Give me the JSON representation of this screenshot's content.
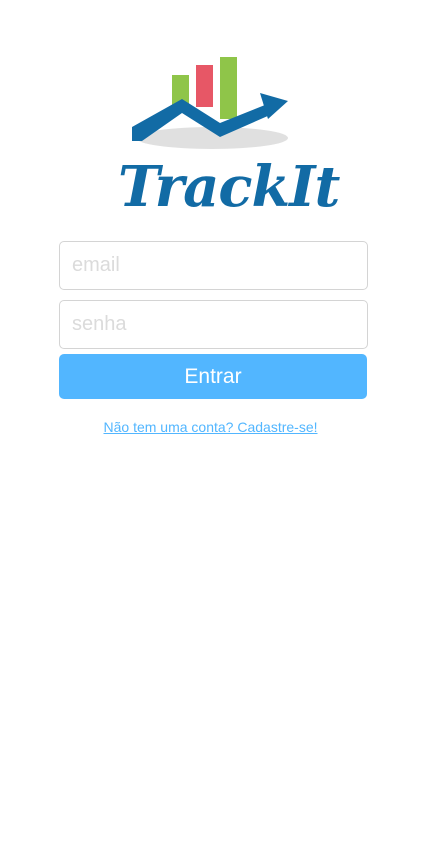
{
  "brand": {
    "name": "TrackIt",
    "colors": {
      "primary_blue": "#126ba5",
      "accent_blue": "#52b6ff",
      "bar_green": "#8fc549",
      "bar_red": "#e75766",
      "shadow_gray": "#e0e0e0"
    },
    "logo_icon": "chart-trend-icon"
  },
  "login_form": {
    "email_placeholder": "email",
    "password_placeholder": "senha",
    "submit_label": "Entrar",
    "signup_link": "Não tem uma conta? Cadastre-se!"
  }
}
